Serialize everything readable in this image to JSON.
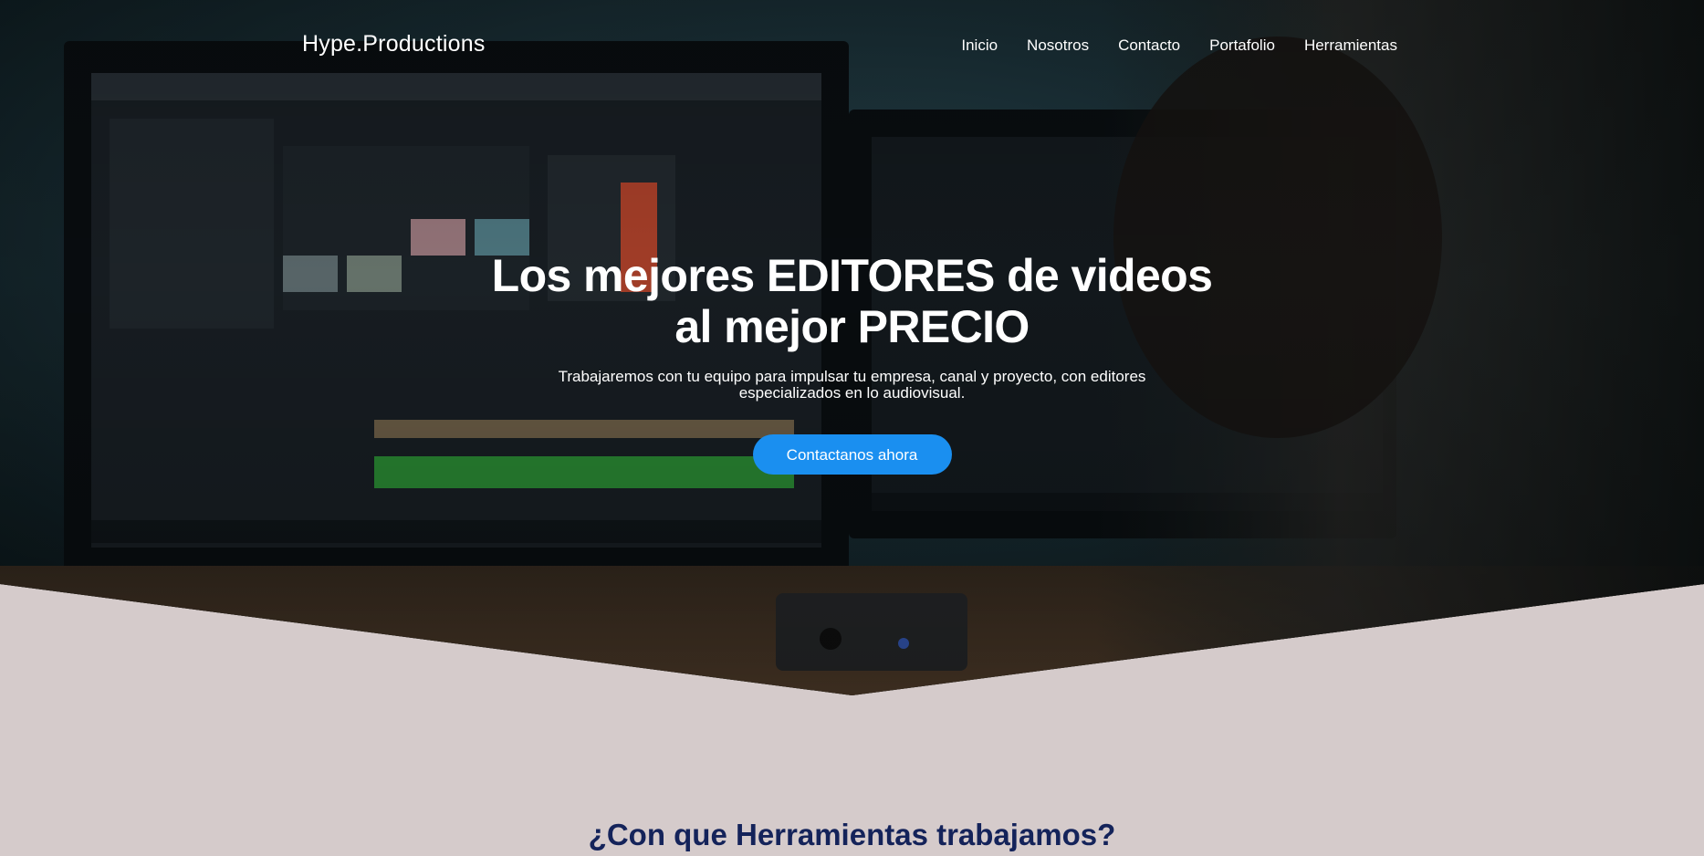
{
  "nav": {
    "brand": "Hype.Productions",
    "items": [
      {
        "label": "Inicio"
      },
      {
        "label": "Nosotros"
      },
      {
        "label": "Contacto"
      },
      {
        "label": "Portafolio"
      },
      {
        "label": "Herramientas"
      }
    ]
  },
  "hero": {
    "title_line1": "Los mejores EDITORES de videos",
    "title_line2": "al mejor PRECIO",
    "subtitle": "Trabajaremos con tu equipo para impulsar tu empresa, canal y proyecto, con editores especializados en lo audiovisual.",
    "cta_label": "Contactanos ahora",
    "background_image": "video-editing-workstation"
  },
  "tools_section": {
    "title": "¿Con que Herramientas trabajamos?"
  },
  "colors": {
    "accent": "#1a8ff0",
    "section_bg": "#d5cbcb",
    "heading_dark": "#14235a"
  }
}
